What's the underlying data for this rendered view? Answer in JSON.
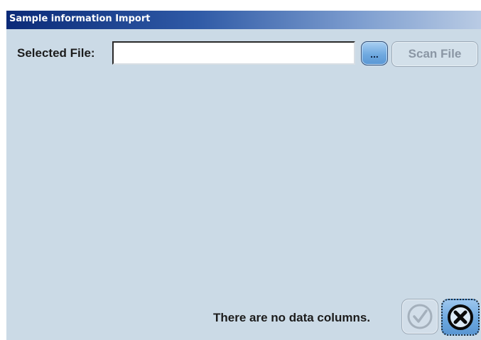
{
  "window": {
    "title": "Sample information Import"
  },
  "file": {
    "label": "Selected File:",
    "value": "",
    "placeholder": ""
  },
  "buttons": {
    "browse_label": "...",
    "scan_label": "Scan File",
    "ok_icon": "checkmark-circle-icon",
    "cancel_icon": "x-circle-icon"
  },
  "status": {
    "message": "There are no data columns."
  },
  "colors": {
    "background": "#cbdae6",
    "titlebar_start": "#0b2a78",
    "accent_button": "#6fa9e0",
    "disabled_text": "#8a96a4"
  }
}
